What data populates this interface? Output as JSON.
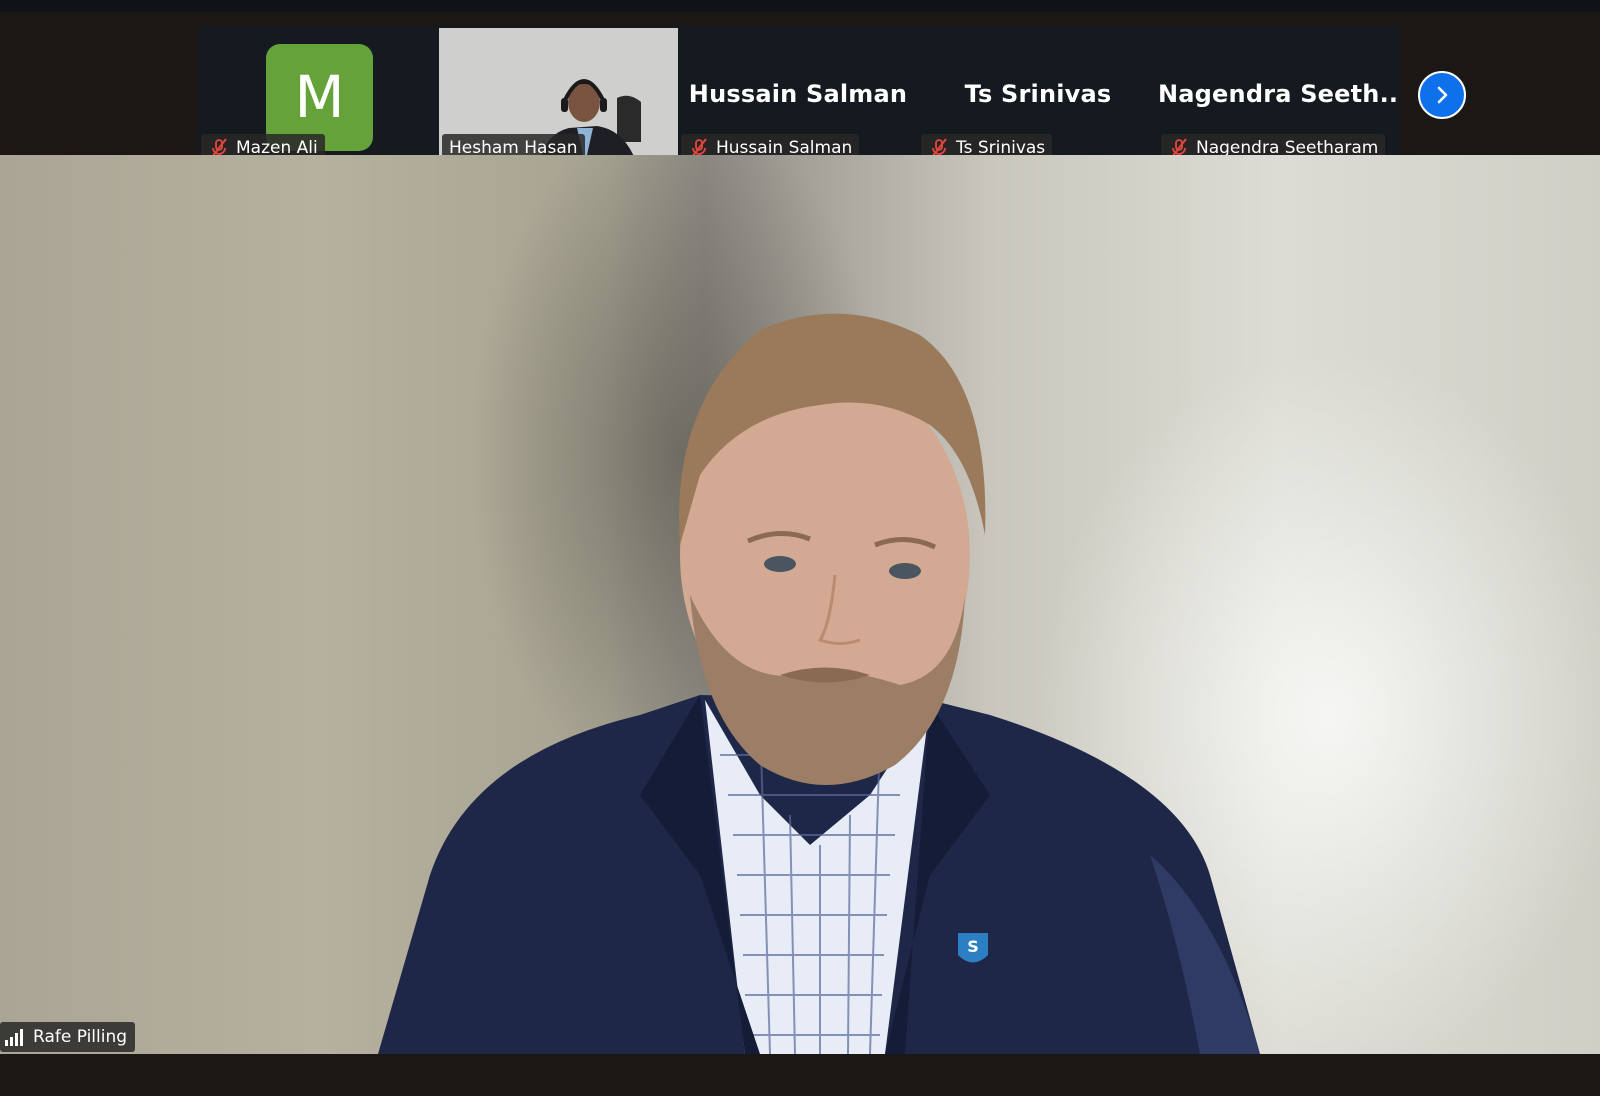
{
  "participants": [
    {
      "name_label": "Mazen Ali",
      "avatar_letter": "M",
      "muted": true,
      "type": "avatar",
      "avatar_color": "#66a23a"
    },
    {
      "name_label": "Hesham Hasan",
      "muted": false,
      "type": "video"
    },
    {
      "name_label": "Hussain Salman",
      "display_name": "Hussain Salman",
      "muted": true,
      "type": "name"
    },
    {
      "name_label": "Ts Srinivas",
      "display_name": "Ts Srinivas",
      "muted": true,
      "type": "name"
    },
    {
      "name_label": "Nagendra Seetharam",
      "display_name": "Nagendra  Seeth...",
      "muted": true,
      "type": "name"
    }
  ],
  "active_speaker": {
    "name": "Rafe Pilling",
    "signal_icon": "signal-bars-icon"
  },
  "controls": {
    "next_page_icon": "chevron-right-icon"
  },
  "colors": {
    "accent": "#0e71eb",
    "mute_red": "#e5453d",
    "strip_bg": "#141a1f"
  },
  "pin_letter": "S"
}
